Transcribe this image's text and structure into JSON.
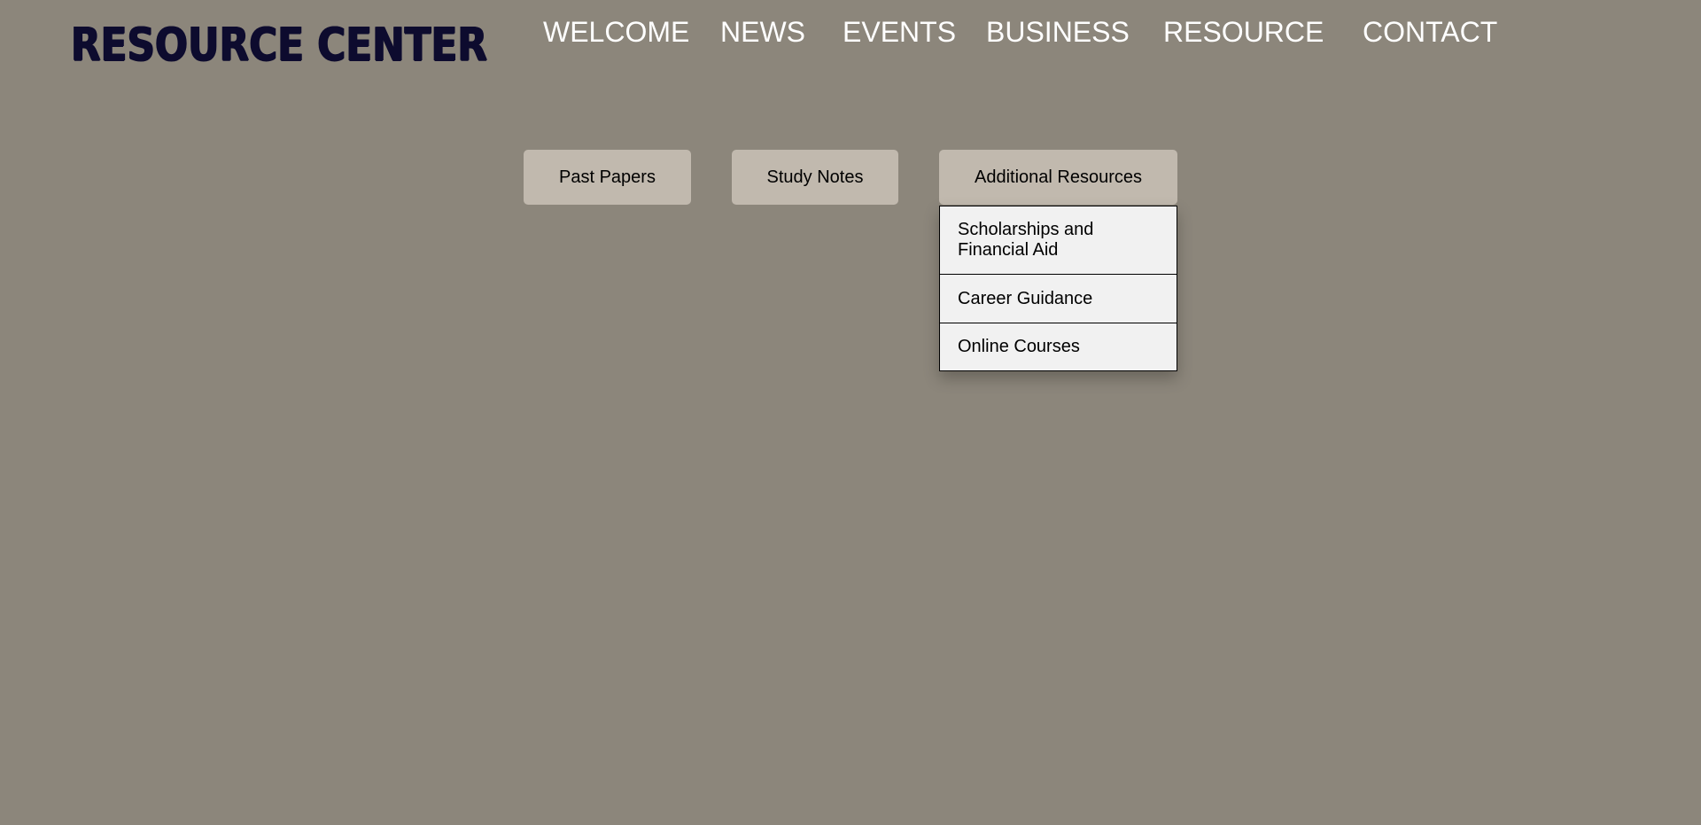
{
  "logo": {
    "text": "RESOURCE CENTER",
    "color": "#0d0b2e"
  },
  "nav": {
    "items": [
      {
        "label": "WELCOME"
      },
      {
        "label": "NEWS"
      },
      {
        "label": "EVENTS"
      },
      {
        "label": "BUSINESS"
      },
      {
        "label": "RESOURCE"
      },
      {
        "label": "CONTACT"
      }
    ]
  },
  "tabs": {
    "past_papers": "Past Papers",
    "study_notes": "Study Notes",
    "additional_resources": "Additional Resources"
  },
  "dropdown": {
    "items": [
      {
        "label": "Scholarships and Financial Aid"
      },
      {
        "label": "Career Guidance"
      },
      {
        "label": "Online Courses"
      }
    ]
  },
  "colors": {
    "background": "#8c867b",
    "button": "#c1b9ae",
    "dropdown_bg": "#f1f1f1",
    "nav_text": "#ffffff"
  }
}
